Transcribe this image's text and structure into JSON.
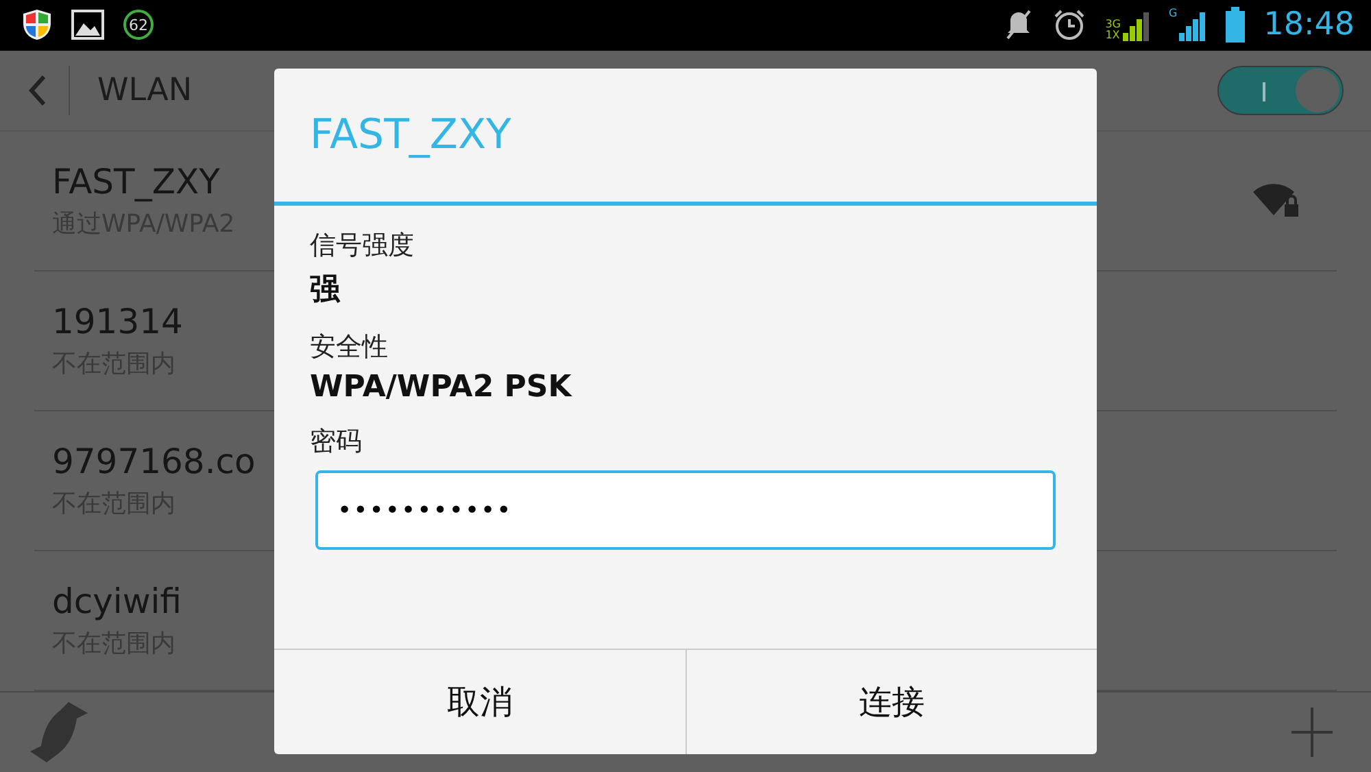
{
  "status_bar": {
    "battery_badge": "62",
    "network_3g": "3G",
    "network_1x": "1X",
    "network_g": "G",
    "time": "18:48"
  },
  "action_bar": {
    "title": "WLAN",
    "wlan_switch": {
      "on": true
    }
  },
  "networks": [
    {
      "name": "FAST_ZXY",
      "status": "通过WPA/WPA2",
      "secured": true
    },
    {
      "name": "191314",
      "status": "不在范围内",
      "secured": false
    },
    {
      "name": "9797168.co",
      "status": "不在范围内",
      "secured": false
    },
    {
      "name": "dcyiwifi",
      "status": "不在范围内",
      "secured": false
    }
  ],
  "dialog": {
    "title": "FAST_ZXY",
    "fields": [
      {
        "label": "信号强度",
        "value": "强"
      },
      {
        "label": "安全性",
        "value": "WPA/WPA2 PSK"
      }
    ],
    "password": {
      "label": "密码",
      "value": "•••••••••••"
    },
    "buttons": [
      "取消",
      "连接"
    ]
  }
}
